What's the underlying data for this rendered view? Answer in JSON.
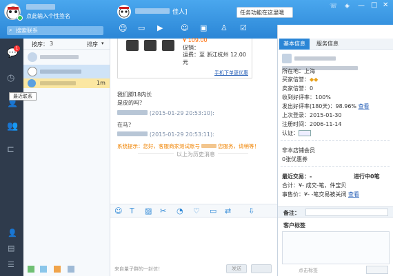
{
  "header": {
    "signature_placeholder": "点此输入个性签名",
    "search_placeholder": "搜索联系",
    "chat_title_suffix": "佳人]",
    "tooltip": "任务功能在这里哦",
    "window_controls": [
      "phone-icon",
      "skin-icon",
      "minimize-icon",
      "maximize-icon",
      "close-icon"
    ]
  },
  "leftnav": {
    "badge": "1",
    "tooltip": "最近联系"
  },
  "contacts": {
    "sort_label": "按序：",
    "count": "3",
    "order_label": "排序",
    "time_label": "1m"
  },
  "product": {
    "price": "¥ 109.00",
    "ship_label": "运费：至 浙江杭州 12.00 元",
    "promo_label": "促销：",
    "order_link": "手机下单更优惠"
  },
  "messages": {
    "m1": "我们脚18内长",
    "m2": "是皮的吗？",
    "t1": "(2015-01-29 20:53:10):",
    "m3": "在马？",
    "t2": "(2015-01-29 20:53:11):",
    "system": "系统提示：您好，客服商家测试账号",
    "system_tail": "您服务，请稍等！",
    "history": "以上为历史消息"
  },
  "input": {
    "footer": "来自量子群的一封信！",
    "send_label": "发送"
  },
  "right_tabs": [
    "客户",
    "商品",
    "订单"
  ],
  "info_tabs": [
    "基本信息",
    "服务信息"
  ],
  "info": {
    "location": "所在地：上海",
    "buyer_credit": "买家信誉：",
    "seller_credit": "卖家信誉：0",
    "received_rate": "收到好评率：100%",
    "sent_rate": "发出好评率(180天)：98.96%",
    "view": "查看",
    "last_login": "上次登录：2015-01-30",
    "register": "注册时间：2006-11-14",
    "verify": "认证：",
    "member": "非本店铺会员",
    "coupon": "0张优惠券",
    "recent_trade": "最近交易：-",
    "in_progress": "进行中0笔",
    "total": "合计：¥-  成交-笔，件宝贝",
    "refund": "事售价：¥-  -笔交易被关闭",
    "remark_label": "备注：",
    "tag_title": "客户标签",
    "tag_footer": "点击标签"
  },
  "colors": {
    "top_blue": "#3b97e3",
    "nav_dark": "#2f3b4c",
    "selected_row": "#cfe3f7",
    "highlight_row": "#fbe7a2",
    "price_orange": "#ff6a00",
    "system_orange": "#f08300",
    "link_blue": "#2a62b8"
  }
}
